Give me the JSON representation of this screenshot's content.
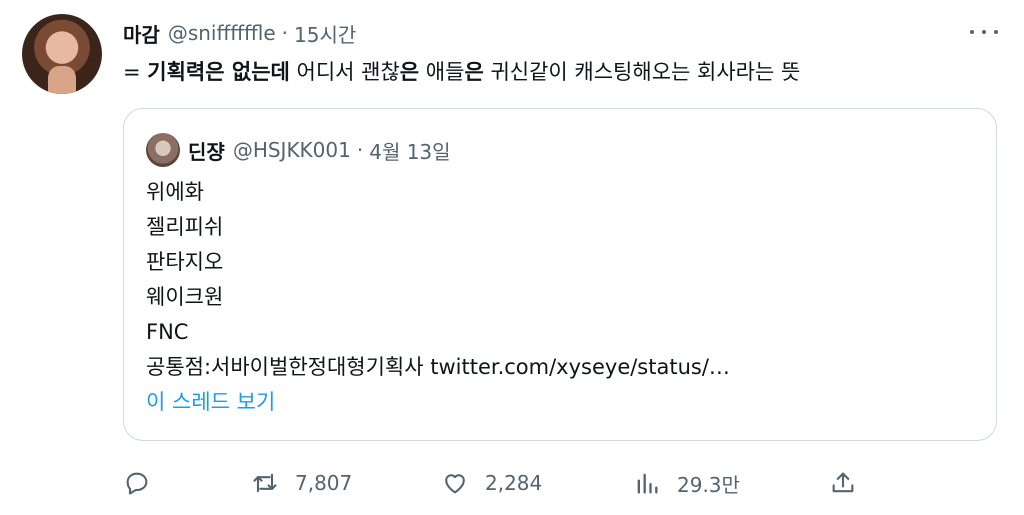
{
  "tweet": {
    "author_name": "마감",
    "handle": "@sniffffffle",
    "separator": "·",
    "time": "15시간",
    "text_parts": [
      {
        "text": "= ",
        "bold": false
      },
      {
        "text": "기획력은 없는데",
        "bold": true
      },
      {
        "text": " 어디서 괜찮",
        "bold": false
      },
      {
        "text": "은",
        "bold": true
      },
      {
        "text": " 애들",
        "bold": false
      },
      {
        "text": "은",
        "bold": true
      },
      {
        "text": " 귀신같이 캐스팅해오는 회사라는 뜻",
        "bold": false
      }
    ]
  },
  "quote": {
    "author_name": "딘쟝",
    "handle": "@HSJKK001",
    "separator": "·",
    "date": "4월 13일",
    "lines": [
      "위에화",
      "젤리피쉬",
      "판타지오",
      "웨이크원",
      "FNC"
    ],
    "last_line_text": "공통점:서바이벌한정대형기획사 ",
    "link_text": "twitter.com/xyseye/status/…",
    "show_thread": "이 스레드 보기"
  },
  "actions": {
    "reply_count": "",
    "retweet_count": "7,807",
    "like_count": "2,284",
    "view_count": "29.3만"
  },
  "icons": {
    "avatar": "profile-photo",
    "more": "more-icon",
    "reply": "reply-icon",
    "retweet": "retweet-icon",
    "like": "heart-icon",
    "views": "views-icon",
    "share": "share-icon"
  },
  "colors": {
    "text": "#0f1419",
    "secondary": "#536471",
    "link": "#1d9bf0",
    "border": "#cfd9de"
  }
}
